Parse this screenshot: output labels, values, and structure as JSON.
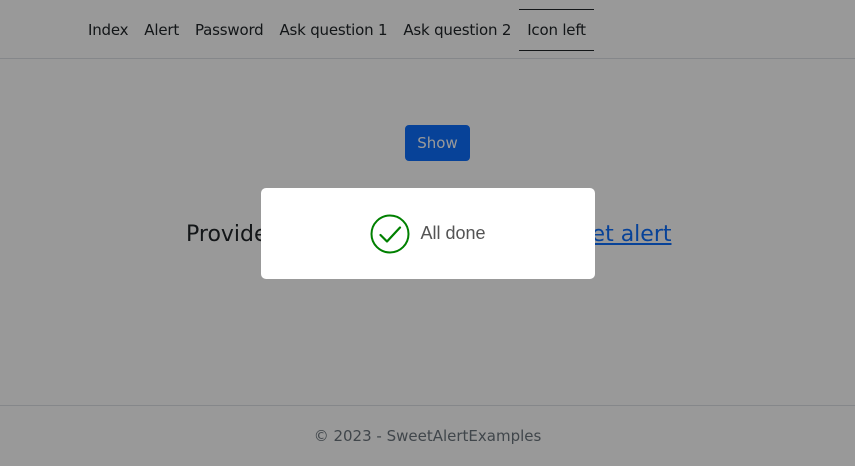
{
  "navbar": {
    "links": [
      "Index",
      "Alert",
      "Password",
      "Ask question 1",
      "Ask question 2",
      "Icon left"
    ],
    "active_index": 5
  },
  "main": {
    "show_button_label": "Show",
    "provider_prefix": "Provide",
    "provider_link_fragment": "eet alert"
  },
  "footer": {
    "text": "© 2023 - SweetAlertExamples"
  },
  "toast": {
    "icon": "success-check-icon",
    "title": "All done"
  },
  "colors": {
    "primary": "#0d6efd",
    "success": "#008000",
    "overlay": "rgba(0,0,0,0.4)"
  }
}
